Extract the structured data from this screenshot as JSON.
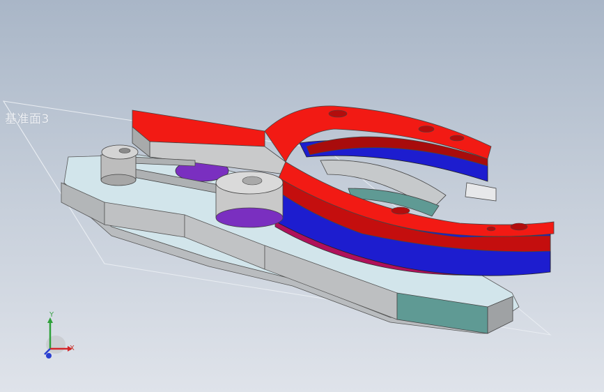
{
  "viewport": {
    "plane_label": "基准面3"
  },
  "triad": {
    "x_label": "X",
    "y_label": "Y",
    "x_color": "#d4262a",
    "y_color": "#2ea03a",
    "z_color": "#2a3fd0"
  },
  "model_colors": {
    "top_plate": "#f21a14",
    "mid_ring": "#1a1ad6",
    "bottom_ring": "#b0105a",
    "base_plate": "#ccd8df",
    "base_side": "#b9bcbf",
    "pulley": "#c9c9c9",
    "teal_block": "#5f9a94",
    "violet_disc": "#7a2fc0"
  }
}
